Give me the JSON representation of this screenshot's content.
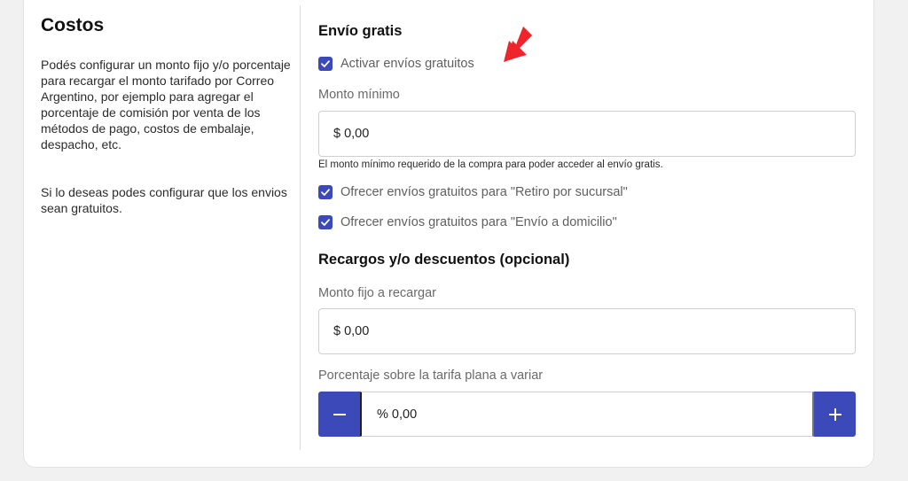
{
  "costos": {
    "title": "Costos",
    "description_1": "Podés configurar un monto fijo y/o porcentaje para recargar el monto tarifado por Correo Argentino, por ejemplo para agregar el porcentaje de comisión por venta de los métodos de pago, costos de embalaje, despacho, etc.",
    "description_2": "Si lo deseas podes configurar que los envios sean gratuitos."
  },
  "envio_gratis": {
    "title": "Envío gratis",
    "activar_label": "Activar envíos gratuitos",
    "activar_checked": true,
    "monto_minimo_label": "Monto mínimo",
    "monto_minimo_value": "$ 0,00",
    "monto_minimo_hint": "El monto mínimo requerido de la compra para poder acceder al envío gratis.",
    "retiro_label": "Ofrecer envíos gratuitos para \"Retiro por sucursal\"",
    "retiro_checked": true,
    "domicilio_label": "Ofrecer envíos gratuitos para \"Envío a domicilio\"",
    "domicilio_checked": true
  },
  "recargos": {
    "title": "Recargos y/o descuentos (opcional)",
    "monto_fijo_label": "Monto fijo a recargar",
    "monto_fijo_value": "$ 0,00",
    "porcentaje_label": "Porcentaje sobre la tarifa plana a variar",
    "porcentaje_value": "% 0,00",
    "minus_symbol": "−",
    "plus_symbol": "+"
  },
  "colors": {
    "accent": "#3b49b9",
    "arrow": "#f0252b"
  },
  "icons": {
    "checkbox": "check-icon",
    "arrow": "red-arrow-icon",
    "minus": "minus-icon",
    "plus": "plus-icon"
  }
}
